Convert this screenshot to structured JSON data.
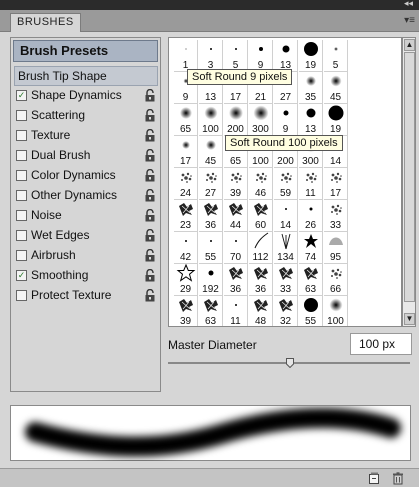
{
  "panel": {
    "tab": "BRUSHES",
    "collapse": "◂◂",
    "menu": "▾≡"
  },
  "left": {
    "presets": "Brush Presets",
    "options": [
      {
        "label": "Brush Tip Shape",
        "checkbox": false,
        "checked": false,
        "lock": false
      },
      {
        "label": "Shape Dynamics",
        "checkbox": true,
        "checked": true,
        "lock": true
      },
      {
        "label": "Scattering",
        "checkbox": true,
        "checked": false,
        "lock": true
      },
      {
        "label": "Texture",
        "checkbox": true,
        "checked": false,
        "lock": true
      },
      {
        "label": "Dual Brush",
        "checkbox": true,
        "checked": false,
        "lock": true
      },
      {
        "label": "Color Dynamics",
        "checkbox": true,
        "checked": false,
        "lock": true
      },
      {
        "label": "Other Dynamics",
        "checkbox": true,
        "checked": false,
        "lock": true
      },
      {
        "label": "Noise",
        "checkbox": true,
        "checked": false,
        "lock": true
      },
      {
        "label": "Wet Edges",
        "checkbox": true,
        "checked": false,
        "lock": true
      },
      {
        "label": "Airbrush",
        "checkbox": true,
        "checked": false,
        "lock": true
      },
      {
        "label": "Smoothing",
        "checkbox": true,
        "checked": true,
        "lock": true
      },
      {
        "label": "Protect Texture",
        "checkbox": true,
        "checked": false,
        "lock": true
      }
    ]
  },
  "brushes": {
    "rows": [
      [
        {
          "size": "1",
          "kind": "hard",
          "d": 1
        },
        {
          "size": "3",
          "kind": "hard",
          "d": 2
        },
        {
          "size": "5",
          "kind": "hard",
          "d": 2
        },
        {
          "size": "9",
          "kind": "hard",
          "d": 4
        },
        {
          "size": "13",
          "kind": "hard",
          "d": 7
        },
        {
          "size": "19",
          "kind": "hard",
          "d": 14
        },
        {
          "size": "5",
          "kind": "soft",
          "d": 2
        }
      ],
      [
        {
          "size": "9",
          "kind": "soft",
          "d": 3
        },
        {
          "size": "13",
          "kind": "soft",
          "d": 4
        },
        {
          "size": "17",
          "kind": "soft",
          "d": 5
        },
        {
          "size": "21",
          "kind": "soft",
          "d": 6
        },
        {
          "size": "27",
          "kind": "soft",
          "d": 7
        },
        {
          "size": "35",
          "kind": "soft",
          "d": 8
        },
        {
          "size": "45",
          "kind": "soft",
          "d": 9
        }
      ],
      [
        {
          "size": "65",
          "kind": "soft",
          "d": 10
        },
        {
          "size": "100",
          "kind": "soft",
          "d": 11
        },
        {
          "size": "200",
          "kind": "soft",
          "d": 12
        },
        {
          "size": "300",
          "kind": "soft",
          "d": 13
        },
        {
          "size": "9",
          "kind": "hard",
          "d": 5
        },
        {
          "size": "13",
          "kind": "hard",
          "d": 9
        },
        {
          "size": "19",
          "kind": "hard",
          "d": 15
        }
      ],
      [
        {
          "size": "17",
          "kind": "soft",
          "d": 6
        },
        {
          "size": "45",
          "kind": "soft",
          "d": 8
        },
        {
          "size": "65",
          "kind": "soft",
          "d": 9
        },
        {
          "size": "100",
          "kind": "soft",
          "d": 10
        },
        {
          "size": "200",
          "kind": "soft",
          "d": 11
        },
        {
          "size": "300",
          "kind": "soft",
          "d": 12
        },
        {
          "size": "14",
          "kind": "splat",
          "d": 8
        }
      ],
      [
        {
          "size": "24",
          "kind": "splat",
          "d": 10
        },
        {
          "size": "27",
          "kind": "splat",
          "d": 10
        },
        {
          "size": "39",
          "kind": "splat",
          "d": 10
        },
        {
          "size": "46",
          "kind": "splat",
          "d": 10
        },
        {
          "size": "59",
          "kind": "splat",
          "d": 10
        },
        {
          "size": "11",
          "kind": "splat",
          "d": 6
        },
        {
          "size": "17",
          "kind": "splat",
          "d": 8
        }
      ],
      [
        {
          "size": "23",
          "kind": "leafy",
          "d": 12
        },
        {
          "size": "36",
          "kind": "leafy",
          "d": 12
        },
        {
          "size": "44",
          "kind": "leafy",
          "d": 12
        },
        {
          "size": "60",
          "kind": "leafy",
          "d": 12
        },
        {
          "size": "14",
          "kind": "hard",
          "d": 2
        },
        {
          "size": "26",
          "kind": "hard",
          "d": 3
        },
        {
          "size": "33",
          "kind": "splat",
          "d": 7
        }
      ],
      [
        {
          "size": "42",
          "kind": "hard",
          "d": 2
        },
        {
          "size": "55",
          "kind": "hard",
          "d": 2
        },
        {
          "size": "70",
          "kind": "hard",
          "d": 2
        },
        {
          "size": "112",
          "kind": "stroke",
          "d": 12
        },
        {
          "size": "134",
          "kind": "grass",
          "d": 12
        },
        {
          "size": "74",
          "kind": "star",
          "d": 12
        },
        {
          "size": "95",
          "kind": "leaf",
          "d": 10
        }
      ],
      [
        {
          "size": "29",
          "kind": "star-outline",
          "d": 13
        },
        {
          "size": "192",
          "kind": "hard",
          "d": 5
        },
        {
          "size": "36",
          "kind": "leafy",
          "d": 12
        },
        {
          "size": "36",
          "kind": "leafy",
          "d": 12
        },
        {
          "size": "33",
          "kind": "leafy",
          "d": 12
        },
        {
          "size": "63",
          "kind": "leafy",
          "d": 12
        },
        {
          "size": "66",
          "kind": "splat",
          "d": 10
        }
      ],
      [
        {
          "size": "39",
          "kind": "leafy",
          "d": 12
        },
        {
          "size": "63",
          "kind": "leafy",
          "d": 12
        },
        {
          "size": "11",
          "kind": "hard",
          "d": 2
        },
        {
          "size": "48",
          "kind": "leafy",
          "d": 12
        },
        {
          "size": "32",
          "kind": "leafy",
          "d": 12
        },
        {
          "size": "55",
          "kind": "hard",
          "d": 14
        },
        {
          "size": "100",
          "kind": "soft",
          "d": 11
        }
      ]
    ],
    "tooltips": [
      "Soft Round 9 pixels",
      "Soft Round 100 pixels"
    ]
  },
  "master": {
    "label": "Master Diameter",
    "value": "100 px",
    "slider_fraction": 0.5
  },
  "colors": {
    "selection": "#aab4c3",
    "tooltip_bg": "#fffee1",
    "check_green": "#2c7a2c"
  },
  "icons": {
    "lock": "lock-icon",
    "new_brush": "new-brush-icon",
    "delete": "trash-icon"
  }
}
